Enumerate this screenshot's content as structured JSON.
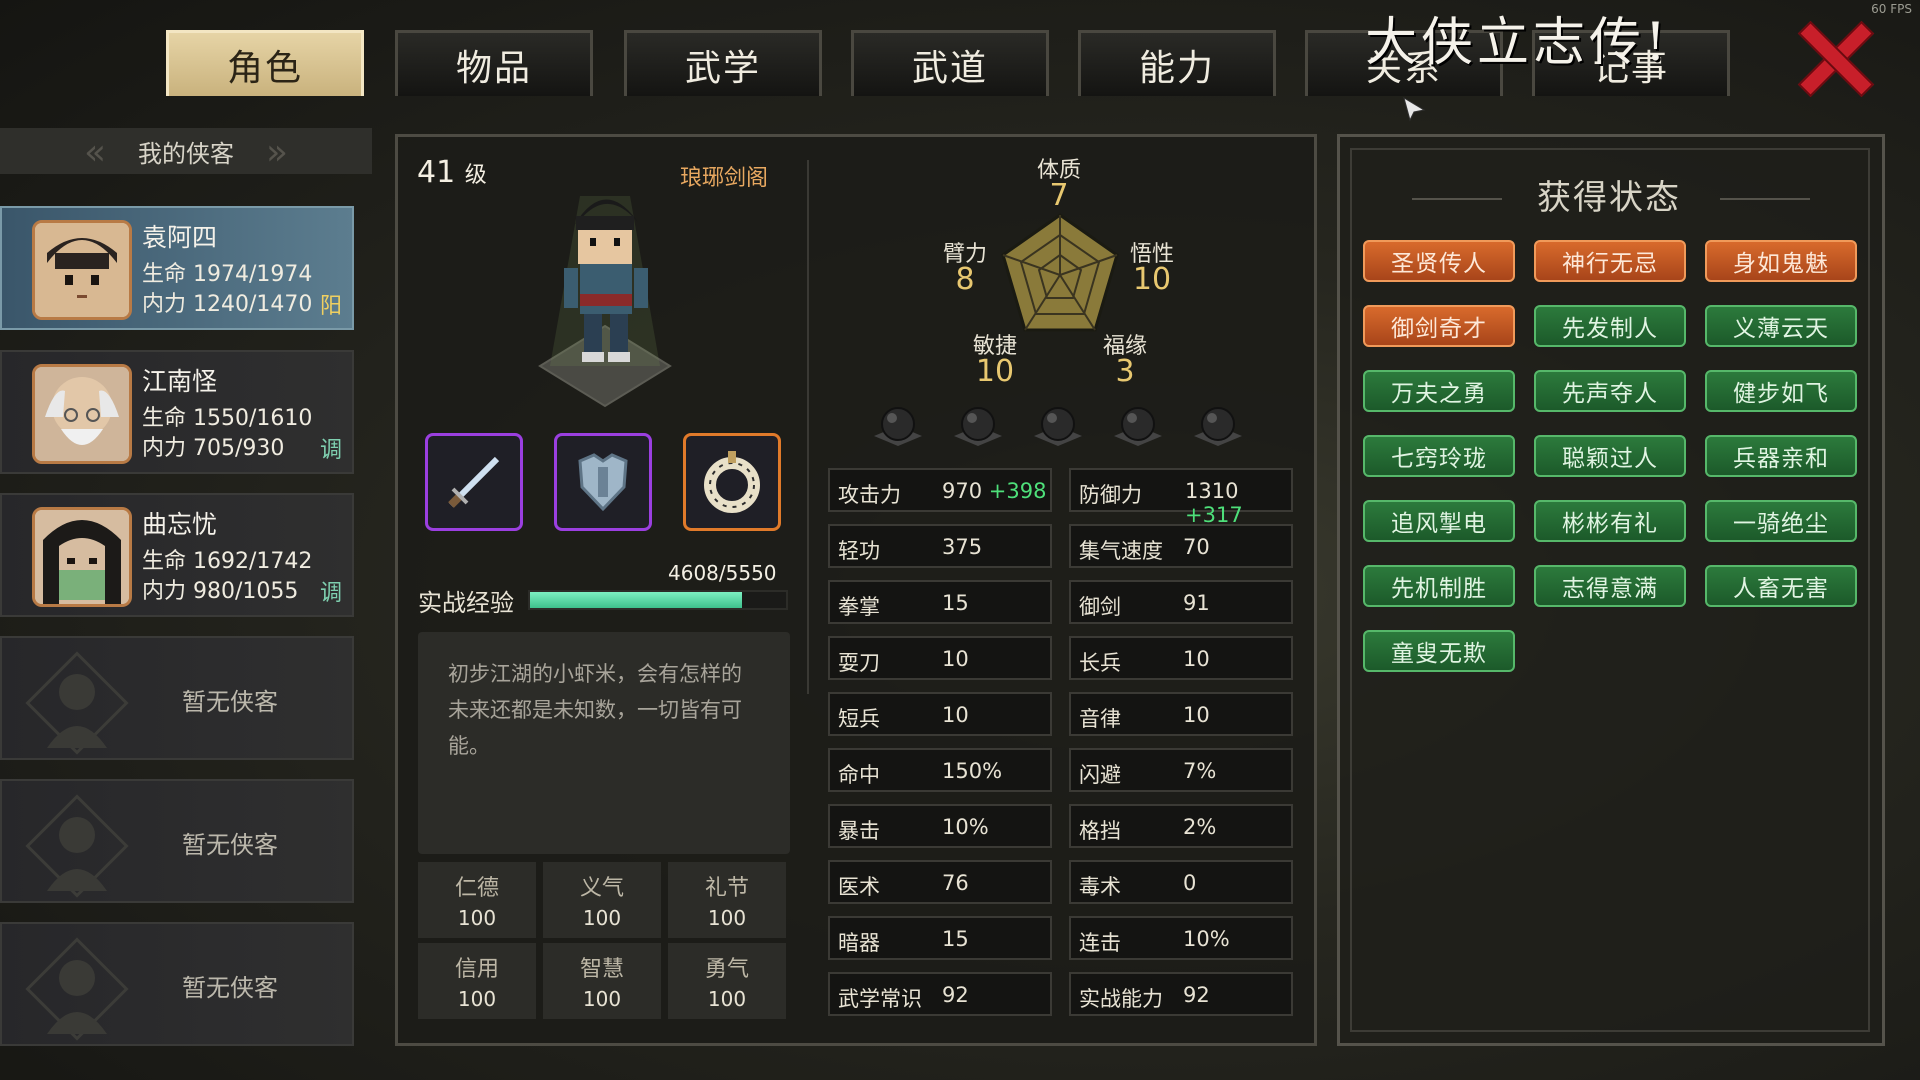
{
  "top": {
    "fps": "60 FPS",
    "watermark": "大侠立志传!",
    "tabs": [
      "角色",
      "物品",
      "武学",
      "武道",
      "能力",
      "关系",
      "记事"
    ],
    "active_tab": 0
  },
  "roster": {
    "header": "我的侠客",
    "members": [
      {
        "name": "袁阿四",
        "hp": "生命 1974/1974",
        "mp": "内力 1240/1470",
        "tag": "阳"
      },
      {
        "name": "江南怪",
        "hp": "生命 1550/1610",
        "mp": "内力 705/930",
        "tag": "调"
      },
      {
        "name": "曲忘忧",
        "hp": "生命 1692/1742",
        "mp": "内力 980/1055",
        "tag": "调"
      }
    ],
    "empty_label": "暂无侠客"
  },
  "character": {
    "level": "41",
    "level_unit": "级",
    "sect": "琅琊剑阁",
    "exp_label": "实战经验",
    "exp_text": "4608/5550",
    "exp_fraction": 0.83,
    "description": "初步江湖的小虾米，会有怎样的未来还都是未知数，一切皆有可能。",
    "virtues": [
      {
        "label": "仁德",
        "value": "100"
      },
      {
        "label": "义气",
        "value": "100"
      },
      {
        "label": "礼节",
        "value": "100"
      },
      {
        "label": "信用",
        "value": "100"
      },
      {
        "label": "智慧",
        "value": "100"
      },
      {
        "label": "勇气",
        "value": "100"
      }
    ]
  },
  "radar": {
    "attrs": [
      {
        "label": "体质",
        "value": "7"
      },
      {
        "label": "悟性",
        "value": "10"
      },
      {
        "label": "福缘",
        "value": "3"
      },
      {
        "label": "敏捷",
        "value": "10"
      },
      {
        "label": "臂力",
        "value": "8"
      }
    ]
  },
  "stats": [
    {
      "label": "攻击力",
      "value": "970",
      "bonus": "+398"
    },
    {
      "label": "防御力",
      "value": "1310",
      "bonus": "+317"
    },
    {
      "label": "轻功",
      "value": "375"
    },
    {
      "label": "集气速度",
      "value": "70"
    },
    {
      "label": "拳掌",
      "value": "15"
    },
    {
      "label": "御剑",
      "value": "91"
    },
    {
      "label": "耍刀",
      "value": "10"
    },
    {
      "label": "长兵",
      "value": "10"
    },
    {
      "label": "短兵",
      "value": "10"
    },
    {
      "label": "音律",
      "value": "10"
    },
    {
      "label": "命中",
      "value": "150%"
    },
    {
      "label": "闪避",
      "value": "7%"
    },
    {
      "label": "暴击",
      "value": "10%"
    },
    {
      "label": "格挡",
      "value": "2%"
    },
    {
      "label": "医术",
      "value": "76"
    },
    {
      "label": "毒术",
      "value": "0"
    },
    {
      "label": "暗器",
      "value": "15"
    },
    {
      "label": "连击",
      "value": "10%"
    },
    {
      "label": "武学常识",
      "value": "92"
    },
    {
      "label": "实战能力",
      "value": "92"
    }
  ],
  "status": {
    "title": "获得状态",
    "badges": [
      {
        "label": "圣贤传人",
        "color": "orange"
      },
      {
        "label": "神行无忌",
        "color": "orange"
      },
      {
        "label": "身如鬼魅",
        "color": "orange"
      },
      {
        "label": "御剑奇才",
        "color": "orange"
      },
      {
        "label": "先发制人",
        "color": "green"
      },
      {
        "label": "义薄云天",
        "color": "green"
      },
      {
        "label": "万夫之勇",
        "color": "green"
      },
      {
        "label": "先声夺人",
        "color": "green"
      },
      {
        "label": "健步如飞",
        "color": "green"
      },
      {
        "label": "七窍玲珑",
        "color": "green"
      },
      {
        "label": "聪颖过人",
        "color": "green"
      },
      {
        "label": "兵器亲和",
        "color": "green"
      },
      {
        "label": "追风掣电",
        "color": "green"
      },
      {
        "label": "彬彬有礼",
        "color": "green"
      },
      {
        "label": "一骑绝尘",
        "color": "green"
      },
      {
        "label": "先机制胜",
        "color": "green"
      },
      {
        "label": "志得意满",
        "color": "green"
      },
      {
        "label": "人畜无害",
        "color": "green"
      },
      {
        "label": "童叟无欺",
        "color": "green"
      }
    ]
  }
}
